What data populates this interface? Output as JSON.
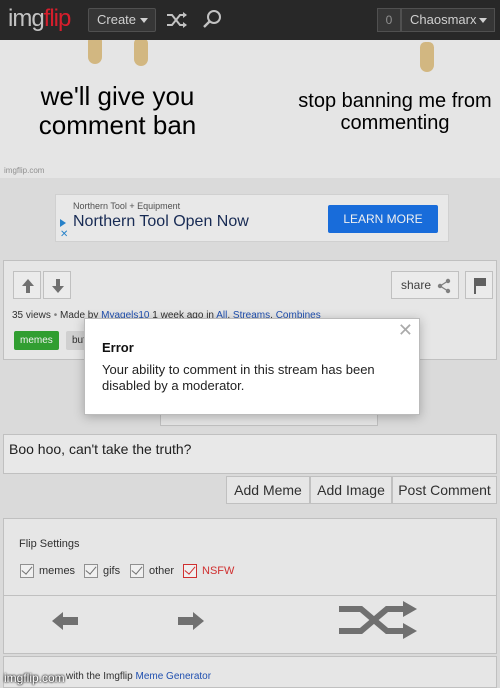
{
  "header": {
    "logo_part1": "img",
    "logo_part2": "flip",
    "create_label": "Create",
    "notifications_count": "0",
    "username": "Chaosmarx"
  },
  "meme": {
    "left_text": "we'll give you comment ban",
    "right_text": "stop banning me from commenting",
    "watermark_small": "imgflip.com"
  },
  "ad": {
    "sponsor": "Northern Tool + Equipment",
    "title": "Northern Tool Open Now",
    "cta": "LEARN MORE"
  },
  "post": {
    "share_label": "share",
    "views": "35 views",
    "made_by_prefix": "Made by",
    "author": "Myagels10",
    "time": "1 week ago in",
    "stream_1": "All",
    "stream_2": "Streams",
    "stream_3": "Combines",
    "tags": [
      "memes",
      "buf"
    ]
  },
  "comment": {
    "text": "Boo hoo, can't take the truth?",
    "add_meme": "Add Meme",
    "add_image": "Add Image",
    "post_comment": "Post Comment"
  },
  "flip_settings": {
    "title": "Flip Settings",
    "options": [
      "memes",
      "gifs",
      "other",
      "NSFW"
    ]
  },
  "meme_generator": {
    "prefix": "with the Imgflip",
    "link": "Meme Generator"
  },
  "error_dialog": {
    "title": "Error",
    "message": "Your ability to comment in this stream has been disabled by a moderator.",
    "close_glyph": "✕"
  },
  "watermark": "imgflip.com",
  "colors": {
    "header_bg": "#2b2b2b",
    "logo_accent": "#e4202f",
    "tag_green": "#35a835",
    "link_blue": "#2255bb",
    "nsfw_red": "#d33333",
    "ad_button": "#1a73e8"
  }
}
